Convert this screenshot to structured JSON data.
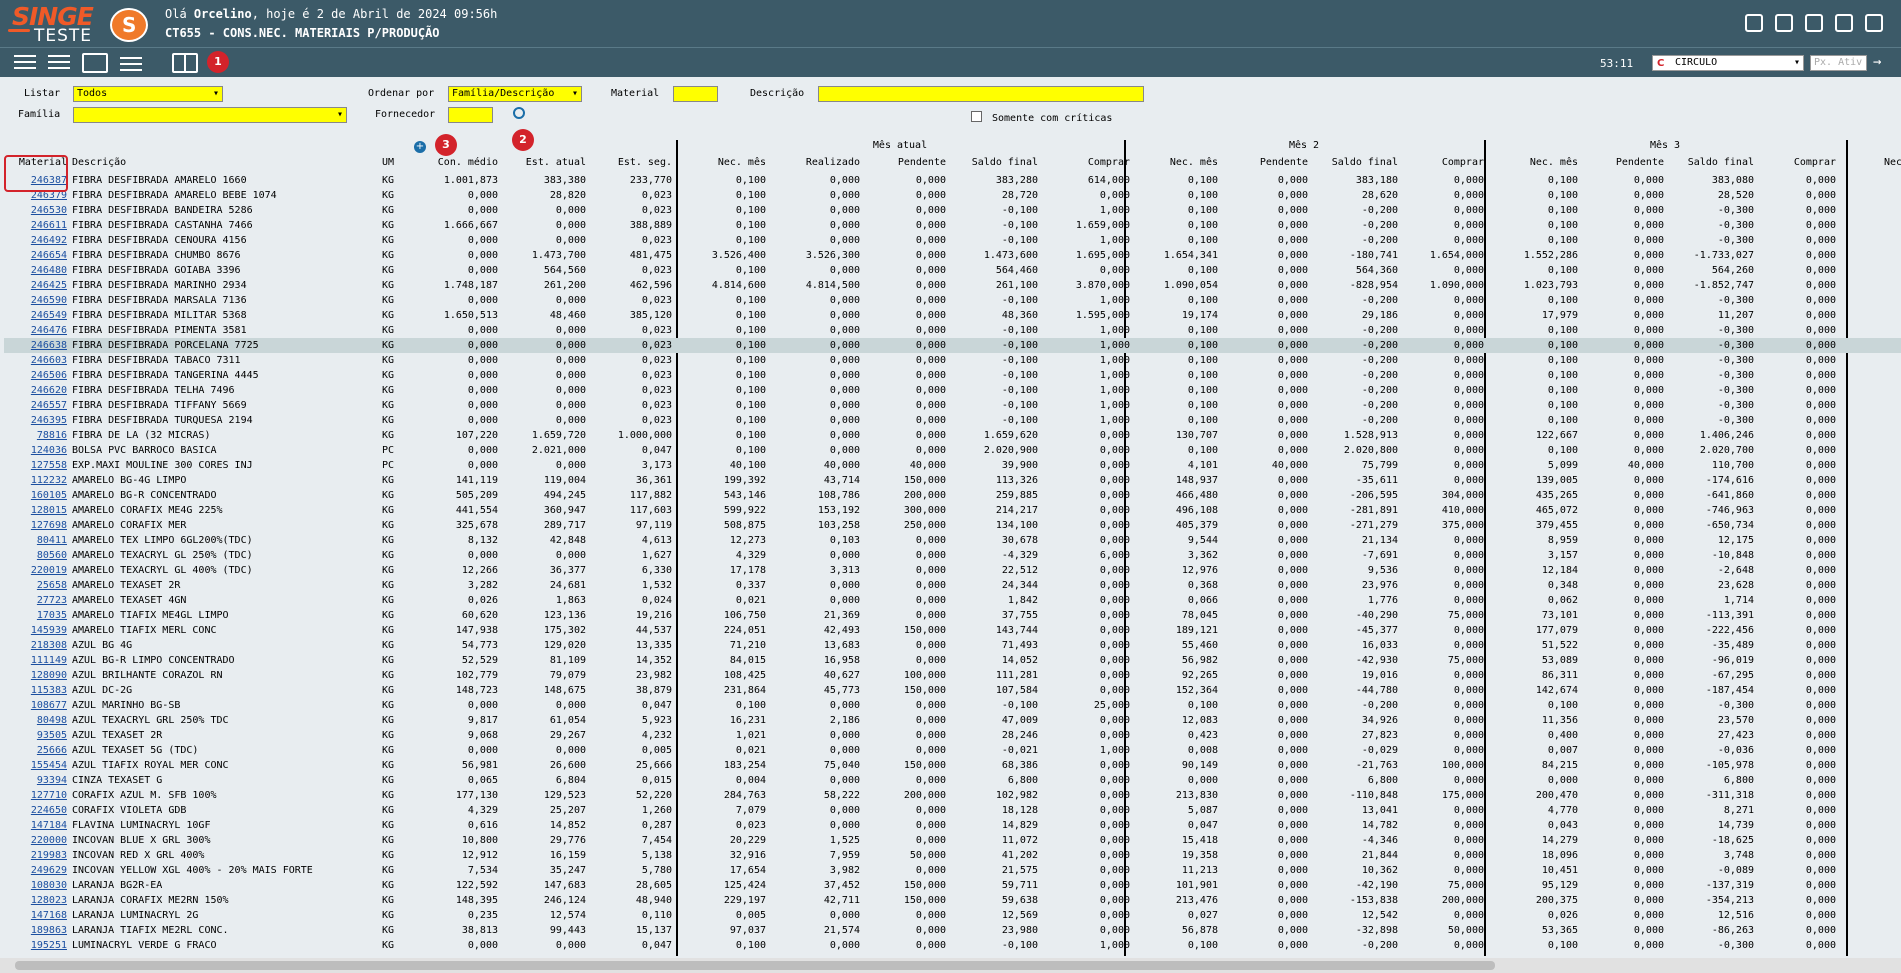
{
  "app": {
    "logo_text": "SINGE",
    "logo_sub": "TESTE",
    "greeting_prefix": "Olá ",
    "user": "Orcelino",
    "greeting_suffix": ", hoje é 2 de Abril de 2024 09:56h",
    "screen_title": "CT655 - CONS.NEC. MATERIAIS P/PRODUÇÃO",
    "timer": "53:11",
    "unit": "CIRCULO",
    "px_placeholder": "Px. Ativ"
  },
  "badges": [
    "1",
    "2",
    "3"
  ],
  "filters": {
    "listar_label": "Listar",
    "listar_value": "Todos",
    "familia_label": "Família",
    "familia_value": "",
    "ordenar_label": "Ordenar por",
    "ordenar_value": "Família/Descrição",
    "fornecedor_label": "Fornecedor",
    "fornecedor_value": "",
    "material_label": "Material",
    "material_value": "",
    "descricao_label": "Descrição",
    "descricao_value": "",
    "criticas_label": "Somente com críticas"
  },
  "groups": [
    "Mês atual",
    "Mês 2",
    "Mês 3"
  ],
  "columns": [
    "Material",
    "Descrição",
    "UM",
    "Con. médio",
    "Est. atual",
    "Est. seg.",
    "Nec. mês",
    "Realizado",
    "Pendente",
    "Saldo final",
    "Comprar",
    "Nec. mês",
    "Pendente",
    "Saldo final",
    "Comprar",
    "Nec. mês",
    "Pendente",
    "Saldo final",
    "Comprar",
    "Nec"
  ],
  "selected_row": 11,
  "rows": [
    [
      "246387",
      "FIBRA DESFIBRADA AMARELO 1660",
      "KG",
      "1.001,873",
      "383,380",
      "233,770",
      "0,100",
      "0,000",
      "0,000",
      "383,280",
      "614,000",
      "0,100",
      "0,000",
      "383,180",
      "0,000",
      "0,100",
      "0,000",
      "383,080",
      "0,000"
    ],
    [
      "246379",
      "FIBRA DESFIBRADA AMARELO BEBE 1074",
      "KG",
      "0,000",
      "28,820",
      "0,023",
      "0,100",
      "0,000",
      "0,000",
      "28,720",
      "0,000",
      "0,100",
      "0,000",
      "28,620",
      "0,000",
      "0,100",
      "0,000",
      "28,520",
      "0,000"
    ],
    [
      "246530",
      "FIBRA DESFIBRADA BANDEIRA 5286",
      "KG",
      "0,000",
      "0,000",
      "0,023",
      "0,100",
      "0,000",
      "0,000",
      "-0,100",
      "1,000",
      "0,100",
      "0,000",
      "-0,200",
      "0,000",
      "0,100",
      "0,000",
      "-0,300",
      "0,000"
    ],
    [
      "246611",
      "FIBRA DESFIBRADA CASTANHA 7466",
      "KG",
      "1.666,667",
      "0,000",
      "388,889",
      "0,100",
      "0,000",
      "0,000",
      "-0,100",
      "1.659,000",
      "0,100",
      "0,000",
      "-0,200",
      "0,000",
      "0,100",
      "0,000",
      "-0,300",
      "0,000"
    ],
    [
      "246492",
      "FIBRA DESFIBRADA CENOURA 4156",
      "KG",
      "0,000",
      "0,000",
      "0,023",
      "0,100",
      "0,000",
      "0,000",
      "-0,100",
      "1,000",
      "0,100",
      "0,000",
      "-0,200",
      "0,000",
      "0,100",
      "0,000",
      "-0,300",
      "0,000"
    ],
    [
      "246654",
      "FIBRA DESFIBRADA CHUMBO 8676",
      "KG",
      "0,000",
      "1.473,700",
      "481,475",
      "3.526,400",
      "3.526,300",
      "0,000",
      "1.473,600",
      "1.695,000",
      "1.654,341",
      "0,000",
      "-180,741",
      "1.654,000",
      "1.552,286",
      "0,000",
      "-1.733,027",
      "0,000"
    ],
    [
      "246480",
      "FIBRA DESFIBRADA GOIABA 3396",
      "KG",
      "0,000",
      "564,560",
      "0,023",
      "0,100",
      "0,000",
      "0,000",
      "564,460",
      "0,000",
      "0,100",
      "0,000",
      "564,360",
      "0,000",
      "0,100",
      "0,000",
      "564,260",
      "0,000"
    ],
    [
      "246425",
      "FIBRA DESFIBRADA MARINHO 2934",
      "KG",
      "1.748,187",
      "261,200",
      "462,596",
      "4.814,600",
      "4.814,500",
      "0,000",
      "261,100",
      "3.870,000",
      "1.090,054",
      "0,000",
      "-828,954",
      "1.090,000",
      "1.023,793",
      "0,000",
      "-1.852,747",
      "0,000"
    ],
    [
      "246590",
      "FIBRA DESFIBRADA MARSALA 7136",
      "KG",
      "0,000",
      "0,000",
      "0,023",
      "0,100",
      "0,000",
      "0,000",
      "-0,100",
      "1,000",
      "0,100",
      "0,000",
      "-0,200",
      "0,000",
      "0,100",
      "0,000",
      "-0,300",
      "0,000"
    ],
    [
      "246549",
      "FIBRA DESFIBRADA MILITAR 5368",
      "KG",
      "1.650,513",
      "48,460",
      "385,120",
      "0,100",
      "0,000",
      "0,000",
      "48,360",
      "1.595,000",
      "19,174",
      "0,000",
      "29,186",
      "0,000",
      "17,979",
      "0,000",
      "11,207",
      "0,000"
    ],
    [
      "246476",
      "FIBRA DESFIBRADA PIMENTA 3581",
      "KG",
      "0,000",
      "0,000",
      "0,023",
      "0,100",
      "0,000",
      "0,000",
      "-0,100",
      "1,000",
      "0,100",
      "0,000",
      "-0,200",
      "0,000",
      "0,100",
      "0,000",
      "-0,300",
      "0,000"
    ],
    [
      "246638",
      "FIBRA DESFIBRADA PORCELANA 7725",
      "KG",
      "0,000",
      "0,000",
      "0,023",
      "0,100",
      "0,000",
      "0,000",
      "-0,100",
      "1,000",
      "0,100",
      "0,000",
      "-0,200",
      "0,000",
      "0,100",
      "0,000",
      "-0,300",
      "0,000"
    ],
    [
      "246603",
      "FIBRA DESFIBRADA TABACO 7311",
      "KG",
      "0,000",
      "0,000",
      "0,023",
      "0,100",
      "0,000",
      "0,000",
      "-0,100",
      "1,000",
      "0,100",
      "0,000",
      "-0,200",
      "0,000",
      "0,100",
      "0,000",
      "-0,300",
      "0,000"
    ],
    [
      "246506",
      "FIBRA DESFIBRADA TANGERINA 4445",
      "KG",
      "0,000",
      "0,000",
      "0,023",
      "0,100",
      "0,000",
      "0,000",
      "-0,100",
      "1,000",
      "0,100",
      "0,000",
      "-0,200",
      "0,000",
      "0,100",
      "0,000",
      "-0,300",
      "0,000"
    ],
    [
      "246620",
      "FIBRA DESFIBRADA TELHA 7496",
      "KG",
      "0,000",
      "0,000",
      "0,023",
      "0,100",
      "0,000",
      "0,000",
      "-0,100",
      "1,000",
      "0,100",
      "0,000",
      "-0,200",
      "0,000",
      "0,100",
      "0,000",
      "-0,300",
      "0,000"
    ],
    [
      "246557",
      "FIBRA DESFIBRADA TIFFANY 5669",
      "KG",
      "0,000",
      "0,000",
      "0,023",
      "0,100",
      "0,000",
      "0,000",
      "-0,100",
      "1,000",
      "0,100",
      "0,000",
      "-0,200",
      "0,000",
      "0,100",
      "0,000",
      "-0,300",
      "0,000"
    ],
    [
      "246395",
      "FIBRA DESFIBRADA TURQUESA 2194",
      "KG",
      "0,000",
      "0,000",
      "0,023",
      "0,100",
      "0,000",
      "0,000",
      "-0,100",
      "1,000",
      "0,100",
      "0,000",
      "-0,200",
      "0,000",
      "0,100",
      "0,000",
      "-0,300",
      "0,000"
    ],
    [
      "78816",
      "FIBRA DE LA (32 MICRAS)",
      "KG",
      "107,220",
      "1.659,720",
      "1.000,000",
      "0,100",
      "0,000",
      "0,000",
      "1.659,620",
      "0,000",
      "130,707",
      "0,000",
      "1.528,913",
      "0,000",
      "122,667",
      "0,000",
      "1.406,246",
      "0,000"
    ],
    [
      "124036",
      "BOLSA PVC BARROCO BASICA",
      "PC",
      "0,000",
      "2.021,000",
      "0,047",
      "0,100",
      "0,000",
      "0,000",
      "2.020,900",
      "0,000",
      "0,100",
      "0,000",
      "2.020,800",
      "0,000",
      "0,100",
      "0,000",
      "2.020,700",
      "0,000"
    ],
    [
      "127558",
      "EXP.MAXI MOULINE 300 CORES INJ",
      "PC",
      "0,000",
      "0,000",
      "3,173",
      "40,100",
      "40,000",
      "40,000",
      "39,900",
      "0,000",
      "4,101",
      "40,000",
      "75,799",
      "0,000",
      "5,099",
      "40,000",
      "110,700",
      "0,000"
    ],
    [
      "112232",
      "AMARELO BG-4G LIMPO",
      "KG",
      "141,119",
      "119,004",
      "36,361",
      "199,392",
      "43,714",
      "150,000",
      "113,326",
      "0,000",
      "148,937",
      "0,000",
      "-35,611",
      "0,000",
      "139,005",
      "0,000",
      "-174,616",
      "0,000"
    ],
    [
      "160105",
      "AMARELO BG-R CONCENTRADO",
      "KG",
      "505,209",
      "494,245",
      "117,882",
      "543,146",
      "108,786",
      "200,000",
      "259,885",
      "0,000",
      "466,480",
      "0,000",
      "-206,595",
      "304,000",
      "435,265",
      "0,000",
      "-641,860",
      "0,000"
    ],
    [
      "128015",
      "AMARELO CORAFIX ME4G 225%",
      "KG",
      "441,554",
      "360,947",
      "117,603",
      "599,922",
      "153,192",
      "300,000",
      "214,217",
      "0,000",
      "496,108",
      "0,000",
      "-281,891",
      "410,000",
      "465,072",
      "0,000",
      "-746,963",
      "0,000"
    ],
    [
      "127698",
      "AMARELO CORAFIX MER",
      "KG",
      "325,678",
      "289,717",
      "97,119",
      "508,875",
      "103,258",
      "250,000",
      "134,100",
      "0,000",
      "405,379",
      "0,000",
      "-271,279",
      "375,000",
      "379,455",
      "0,000",
      "-650,734",
      "0,000"
    ],
    [
      "80411",
      "AMARELO TEX LIMPO 6GL200%(TDC)",
      "KG",
      "8,132",
      "42,848",
      "4,613",
      "12,273",
      "0,103",
      "0,000",
      "30,678",
      "0,000",
      "9,544",
      "0,000",
      "21,134",
      "0,000",
      "8,959",
      "0,000",
      "12,175",
      "0,000"
    ],
    [
      "80560",
      "AMARELO TEXACRYL GL 250% (TDC)",
      "KG",
      "0,000",
      "0,000",
      "1,627",
      "4,329",
      "0,000",
      "0,000",
      "-4,329",
      "6,000",
      "3,362",
      "0,000",
      "-7,691",
      "0,000",
      "3,157",
      "0,000",
      "-10,848",
      "0,000"
    ],
    [
      "220019",
      "AMARELO TEXACRYL GL 400% (TDC)",
      "KG",
      "12,266",
      "36,377",
      "6,330",
      "17,178",
      "3,313",
      "0,000",
      "22,512",
      "0,000",
      "12,976",
      "0,000",
      "9,536",
      "0,000",
      "12,184",
      "0,000",
      "-2,648",
      "0,000"
    ],
    [
      "25658",
      "AMARELO TEXASET 2R",
      "KG",
      "3,282",
      "24,681",
      "1,532",
      "0,337",
      "0,000",
      "0,000",
      "24,344",
      "0,000",
      "0,368",
      "0,000",
      "23,976",
      "0,000",
      "0,348",
      "0,000",
      "23,628",
      "0,000"
    ],
    [
      "27723",
      "AMARELO TEXASET 4GN",
      "KG",
      "0,026",
      "1,863",
      "0,024",
      "0,021",
      "0,000",
      "0,000",
      "1,842",
      "0,000",
      "0,066",
      "0,000",
      "1,776",
      "0,000",
      "0,062",
      "0,000",
      "1,714",
      "0,000"
    ],
    [
      "17035",
      "AMARELO TIAFIX ME4GL LIMPO",
      "KG",
      "60,620",
      "123,136",
      "19,216",
      "106,750",
      "21,369",
      "0,000",
      "37,755",
      "0,000",
      "78,045",
      "0,000",
      "-40,290",
      "75,000",
      "73,101",
      "0,000",
      "-113,391",
      "0,000"
    ],
    [
      "145939",
      "AMARELO TIAFIX MERL CONC",
      "KG",
      "147,938",
      "175,302",
      "44,537",
      "224,051",
      "42,493",
      "150,000",
      "143,744",
      "0,000",
      "189,121",
      "0,000",
      "-45,377",
      "0,000",
      "177,079",
      "0,000",
      "-222,456",
      "0,000"
    ],
    [
      "218308",
      "AZUL BG 4G",
      "KG",
      "54,773",
      "129,020",
      "13,335",
      "71,210",
      "13,683",
      "0,000",
      "71,493",
      "0,000",
      "55,460",
      "0,000",
      "16,033",
      "0,000",
      "51,522",
      "0,000",
      "-35,489",
      "0,000"
    ],
    [
      "111149",
      "AZUL BG-R LIMPO CONCENTRADO",
      "KG",
      "52,529",
      "81,109",
      "14,352",
      "84,015",
      "16,958",
      "0,000",
      "14,052",
      "0,000",
      "56,982",
      "0,000",
      "-42,930",
      "75,000",
      "53,089",
      "0,000",
      "-96,019",
      "0,000"
    ],
    [
      "128090",
      "AZUL BRILHANTE CORAZOL RN",
      "KG",
      "102,779",
      "79,079",
      "23,982",
      "108,425",
      "40,627",
      "100,000",
      "111,281",
      "0,000",
      "92,265",
      "0,000",
      "19,016",
      "0,000",
      "86,311",
      "0,000",
      "-67,295",
      "0,000"
    ],
    [
      "115383",
      "AZUL DC-2G",
      "KG",
      "148,723",
      "148,675",
      "38,879",
      "231,864",
      "45,773",
      "150,000",
      "107,584",
      "0,000",
      "152,364",
      "0,000",
      "-44,780",
      "0,000",
      "142,674",
      "0,000",
      "-187,454",
      "0,000"
    ],
    [
      "108677",
      "AZUL MARINHO BG-SB",
      "KG",
      "0,000",
      "0,000",
      "0,047",
      "0,100",
      "0,000",
      "0,000",
      "-0,100",
      "25,000",
      "0,100",
      "0,000",
      "-0,200",
      "0,000",
      "0,100",
      "0,000",
      "-0,300",
      "0,000"
    ],
    [
      "80498",
      "AZUL TEXACRYL GRL 250% TDC",
      "KG",
      "9,817",
      "61,054",
      "5,923",
      "16,231",
      "2,186",
      "0,000",
      "47,009",
      "0,000",
      "12,083",
      "0,000",
      "34,926",
      "0,000",
      "11,356",
      "0,000",
      "23,570",
      "0,000"
    ],
    [
      "93505",
      "AZUL TEXASET 2R",
      "KG",
      "9,068",
      "29,267",
      "4,232",
      "1,021",
      "0,000",
      "0,000",
      "28,246",
      "0,000",
      "0,423",
      "0,000",
      "27,823",
      "0,000",
      "0,400",
      "0,000",
      "27,423",
      "0,000"
    ],
    [
      "25666",
      "AZUL TEXASET 5G (TDC)",
      "KG",
      "0,000",
      "0,000",
      "0,005",
      "0,021",
      "0,000",
      "0,000",
      "-0,021",
      "1,000",
      "0,008",
      "0,000",
      "-0,029",
      "0,000",
      "0,007",
      "0,000",
      "-0,036",
      "0,000"
    ],
    [
      "155454",
      "AZUL TIAFIX ROYAL MER CONC",
      "KG",
      "56,981",
      "26,600",
      "25,666",
      "183,254",
      "75,040",
      "150,000",
      "68,386",
      "0,000",
      "90,149",
      "0,000",
      "-21,763",
      "100,000",
      "84,215",
      "0,000",
      "-105,978",
      "0,000"
    ],
    [
      "93394",
      "CINZA TEXASET G",
      "KG",
      "0,065",
      "6,804",
      "0,015",
      "0,004",
      "0,000",
      "0,000",
      "6,800",
      "0,000",
      "0,000",
      "0,000",
      "6,800",
      "0,000",
      "0,000",
      "0,000",
      "6,800",
      "0,000"
    ],
    [
      "127710",
      "CORAFIX AZUL M. SFB 100%",
      "KG",
      "177,130",
      "129,523",
      "52,220",
      "284,763",
      "58,222",
      "200,000",
      "102,982",
      "0,000",
      "213,830",
      "0,000",
      "-110,848",
      "175,000",
      "200,470",
      "0,000",
      "-311,318",
      "0,000"
    ],
    [
      "224650",
      "CORAFIX VIOLETA GDB",
      "KG",
      "4,329",
      "25,207",
      "1,260",
      "7,079",
      "0,000",
      "0,000",
      "18,128",
      "0,000",
      "5,087",
      "0,000",
      "13,041",
      "0,000",
      "4,770",
      "0,000",
      "8,271",
      "0,000"
    ],
    [
      "147184",
      "FLAVINA LUMINACRYL 10GF",
      "KG",
      "0,616",
      "14,852",
      "0,287",
      "0,023",
      "0,000",
      "0,000",
      "14,829",
      "0,000",
      "0,047",
      "0,000",
      "14,782",
      "0,000",
      "0,043",
      "0,000",
      "14,739",
      "0,000"
    ],
    [
      "220000",
      "INCOVAN BLUE X GRL 300%",
      "KG",
      "10,800",
      "29,776",
      "7,454",
      "20,229",
      "1,525",
      "0,000",
      "11,072",
      "0,000",
      "15,418",
      "0,000",
      "-4,346",
      "0,000",
      "14,279",
      "0,000",
      "-18,625",
      "0,000"
    ],
    [
      "219983",
      "INCOVAN RED X GRL 400%",
      "KG",
      "12,912",
      "16,159",
      "5,138",
      "32,916",
      "7,959",
      "50,000",
      "41,202",
      "0,000",
      "19,358",
      "0,000",
      "21,844",
      "0,000",
      "18,096",
      "0,000",
      "3,748",
      "0,000"
    ],
    [
      "249629",
      "INCOVAN YELLOW XGL 400% - 20% MAIS FORTE",
      "KG",
      "7,534",
      "35,247",
      "5,780",
      "17,654",
      "3,982",
      "0,000",
      "21,575",
      "0,000",
      "11,213",
      "0,000",
      "10,362",
      "0,000",
      "10,451",
      "0,000",
      "-0,089",
      "0,000"
    ],
    [
      "108030",
      "LARANJA BG2R-EA",
      "KG",
      "122,592",
      "147,683",
      "28,605",
      "125,424",
      "37,452",
      "150,000",
      "59,711",
      "0,000",
      "101,901",
      "0,000",
      "-42,190",
      "75,000",
      "95,129",
      "0,000",
      "-137,319",
      "0,000"
    ],
    [
      "128023",
      "LARANJA CORAFIX ME2RN 150%",
      "KG",
      "148,395",
      "246,124",
      "48,940",
      "229,197",
      "42,711",
      "150,000",
      "59,638",
      "0,000",
      "213,476",
      "0,000",
      "-153,838",
      "200,000",
      "200,375",
      "0,000",
      "-354,213",
      "0,000"
    ],
    [
      "147168",
      "LARANJA LUMINACRYL 2G",
      "KG",
      "0,235",
      "12,574",
      "0,110",
      "0,005",
      "0,000",
      "0,000",
      "12,569",
      "0,000",
      "0,027",
      "0,000",
      "12,542",
      "0,000",
      "0,026",
      "0,000",
      "12,516",
      "0,000"
    ],
    [
      "189863",
      "LARANJA TIAFIX ME2RL CONC.",
      "KG",
      "38,813",
      "99,443",
      "15,137",
      "97,037",
      "21,574",
      "0,000",
      "23,980",
      "0,000",
      "56,878",
      "0,000",
      "-32,898",
      "50,000",
      "53,365",
      "0,000",
      "-86,263",
      "0,000"
    ],
    [
      "195251",
      "LUMINACRYL VERDE G FRACO",
      "KG",
      "0,000",
      "0,000",
      "0,047",
      "0,100",
      "0,000",
      "0,000",
      "-0,100",
      "1,000",
      "0,100",
      "0,000",
      "-0,200",
      "0,000",
      "0,100",
      "0,000",
      "-0,300",
      "0,000"
    ]
  ]
}
